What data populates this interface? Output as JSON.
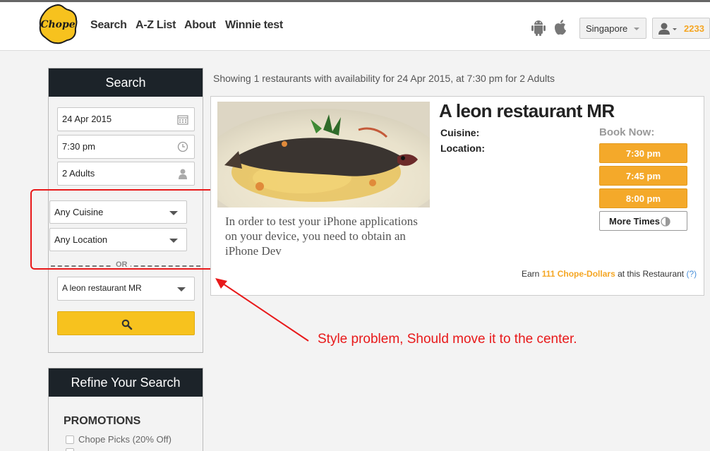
{
  "header": {
    "logo_text": "Chope",
    "nav": [
      "Search",
      "A-Z List",
      "About",
      "Winnie test"
    ],
    "country": "Singapore",
    "chope_dollars": "2233"
  },
  "search_panel": {
    "title": "Search",
    "date": "24 Apr 2015",
    "time": "7:30 pm",
    "guests": "2 Adults",
    "cuisine": "Any Cuisine",
    "location": "Any Location",
    "or_label": "OR",
    "restaurant": "A leon restaurant MR"
  },
  "refine_panel": {
    "title": "Refine Your Search",
    "promotions_title": "PROMOTIONS",
    "promo_option": "Chope Picks (20% Off)"
  },
  "results": {
    "summary": "Showing 1 restaurants with availability for 24 Apr 2015, at 7:30 pm for 2 Adults",
    "restaurant": {
      "name": "A leon restaurant MR",
      "cuisine_label": "Cuisine:",
      "location_label": "Location:",
      "description": "In order to test your iPhone applications on your device, you need to obtain an iPhone Dev",
      "book_now_label": "Book Now:",
      "times": [
        "7:30 pm",
        "7:45 pm",
        "8:00 pm"
      ],
      "more_times_label": "More Times",
      "earn_prefix": "Earn",
      "earn_amount": "111 Chope-Dollars",
      "earn_suffix": "at this Restaurant",
      "earn_help": "(?)"
    }
  },
  "annotation": {
    "text": "Style problem, Should move it to the center."
  },
  "colors": {
    "brand_yellow": "#f7c21e",
    "time_orange": "#f4a92a",
    "annotation_red": "#e8191a",
    "panel_dark": "#1c2329"
  }
}
